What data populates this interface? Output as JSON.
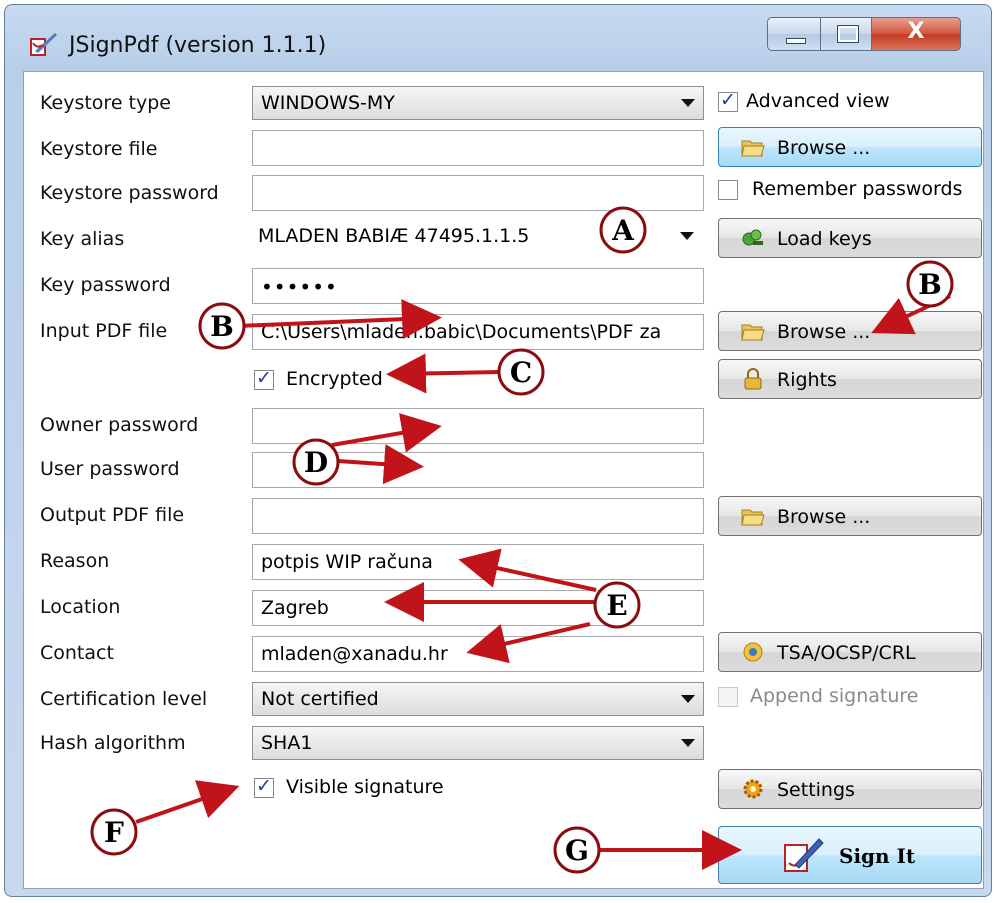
{
  "window": {
    "title": "JSignPdf (version 1.1.1)",
    "controls": [
      "minimize-icon",
      "maximize-icon",
      "close-icon"
    ]
  },
  "labels": {
    "keystore_type": "Keystore type",
    "keystore_file": "Keystore file",
    "keystore_password": "Keystore password",
    "key_alias": "Key alias",
    "key_password": "Key password",
    "input_pdf": "Input PDF file",
    "owner_password": "Owner password",
    "user_password": "User password",
    "output_pdf": "Output PDF file",
    "reason": "Reason",
    "location": "Location",
    "contact": "Contact",
    "cert_level": "Certification level",
    "hash_algorithm": "Hash algorithm"
  },
  "fields": {
    "keystore_type": "WINDOWS-MY",
    "keystore_file": "",
    "keystore_password": "",
    "key_alias": "MLADEN BABIÆ 47495.1.1.5",
    "key_password": "••••••",
    "input_pdf": "C:\\Users\\mladen.babic\\Documents\\PDF za",
    "owner_password": "",
    "user_password": "",
    "output_pdf": "",
    "reason": "potpis WIP računa",
    "location": "Zagreb",
    "contact": "mladen@xanadu.hr",
    "cert_level": "Not certified",
    "hash_algorithm": "SHA1"
  },
  "checkboxes": {
    "advanced_view": {
      "label": "Advanced view",
      "checked": true
    },
    "remember_passwords": {
      "label": "Remember passwords",
      "checked": false
    },
    "encrypted": {
      "label": "Encrypted",
      "checked": true
    },
    "append_signature": {
      "label": "Append signature",
      "checked": false,
      "disabled": true
    },
    "visible_signature": {
      "label": "Visible signature",
      "checked": true
    }
  },
  "buttons": {
    "browse_keystore": "Browse ...",
    "load_keys": "Load keys",
    "browse_input": "Browse ...",
    "rights": "Rights",
    "browse_output": "Browse ...",
    "tsa": "TSA/OCSP/CRL",
    "settings": "Settings",
    "sign": "Sign It"
  },
  "callouts": {
    "a": "A",
    "b1": "B",
    "b2": "B",
    "c": "C",
    "d": "D",
    "e": "E",
    "f": "F",
    "g": "G"
  },
  "colors": {
    "arrow": "#c0141a",
    "accent_blue": "#3c7fb1"
  }
}
